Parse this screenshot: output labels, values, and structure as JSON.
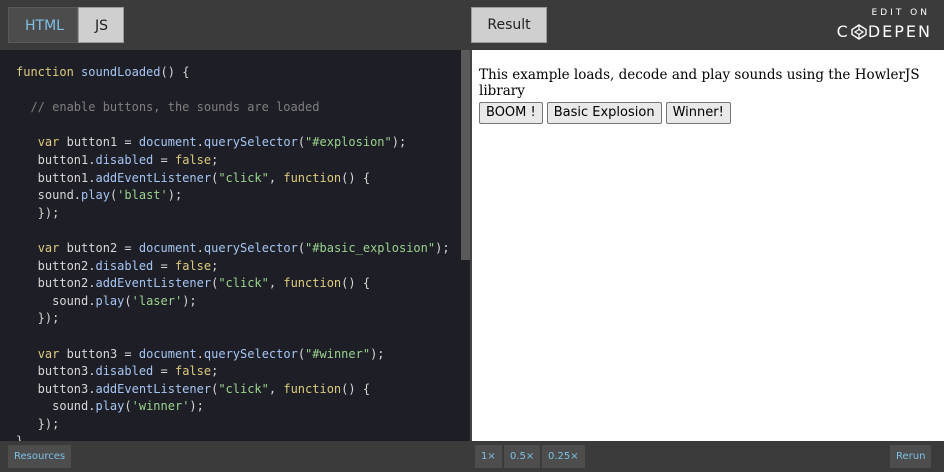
{
  "tabs": {
    "html": "HTML",
    "js": "JS"
  },
  "result_tab": "Result",
  "codepen": {
    "edit_on": "EDIT ON",
    "brand_left": "C",
    "brand_right": "DEPEN"
  },
  "code_lines": [
    "function soundLoaded() {",
    "",
    "  // enable buttons, the sounds are loaded",
    "",
    "   var button1 = document.querySelector(\"#explosion\");",
    "   button1.disabled = false;",
    "   button1.addEventListener(\"click\", function() {",
    "   sound.play('blast');",
    "   });",
    "",
    "   var button2 = document.querySelector(\"#basic_explosion\");",
    "   button2.disabled = false;",
    "   button2.addEventListener(\"click\", function() {",
    "     sound.play('laser');",
    "   });",
    "",
    "   var button3 = document.querySelector(\"#winner\");",
    "   button3.disabled = false;",
    "   button3.addEventListener(\"click\", function() {",
    "     sound.play('winner');",
    "   });",
    "}"
  ],
  "result": {
    "text": "This example loads, decode and play sounds using the HowlerJS library",
    "buttons": [
      "BOOM !",
      "Basic Explosion",
      "Winner!"
    ]
  },
  "bottom": {
    "resources": "Resources",
    "zoom": [
      "1×",
      "0.5×",
      "0.25×"
    ],
    "rerun": "Rerun"
  }
}
